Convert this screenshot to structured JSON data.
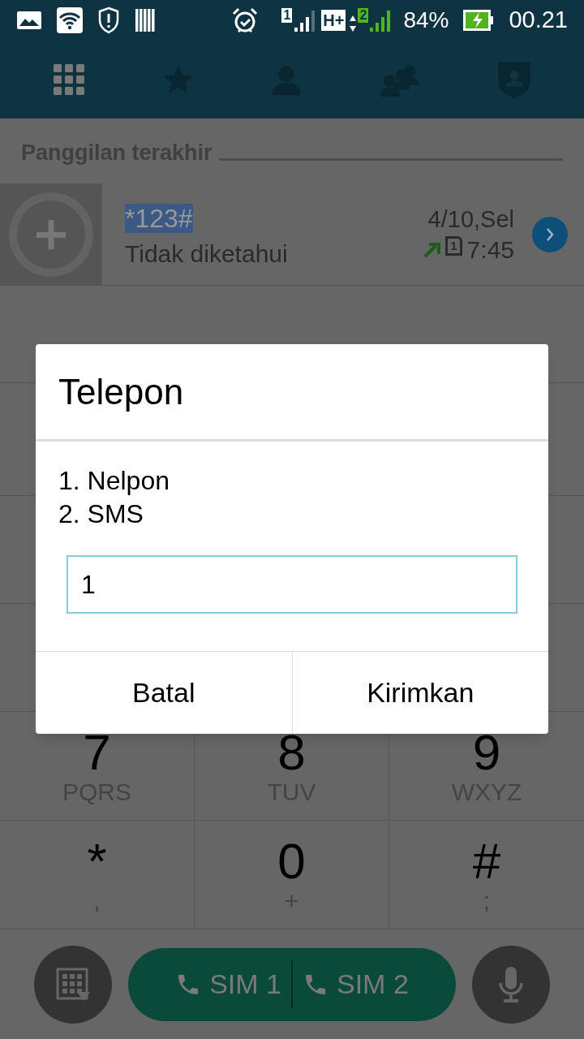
{
  "status_bar": {
    "sim1_label": "1",
    "network_type": "H+",
    "sim2_label": "2",
    "battery": "84%",
    "time": "00.21"
  },
  "tabs": [
    {
      "kind": "dialpad",
      "selected": true
    },
    {
      "kind": "favorites",
      "selected": false
    },
    {
      "kind": "contact",
      "selected": false
    },
    {
      "kind": "groups",
      "selected": false
    },
    {
      "kind": "profile",
      "selected": false
    }
  ],
  "recent_calls": {
    "title": "Panggilan terakhir",
    "items": [
      {
        "number": "*123#",
        "number_highlighted": true,
        "name": "Tidak diketahui",
        "date": "4/10,Sel",
        "sim": "1",
        "time": "7:45",
        "outgoing": true
      }
    ]
  },
  "keypad": [
    {
      "digit": "7",
      "letters": "PQRS"
    },
    {
      "digit": "8",
      "letters": "TUV"
    },
    {
      "digit": "9",
      "letters": "WXYZ"
    },
    {
      "digit": "*",
      "letters": ","
    },
    {
      "digit": "0",
      "letters": "+"
    },
    {
      "digit": "#",
      "letters": ";"
    }
  ],
  "call_buttons": [
    "SIM 1",
    "SIM 2"
  ],
  "dialog": {
    "title": "Telepon",
    "lines": [
      "1. Nelpon",
      "2. SMS"
    ],
    "input_value": "1",
    "buttons": [
      "Batal",
      "Kirimkan"
    ]
  }
}
